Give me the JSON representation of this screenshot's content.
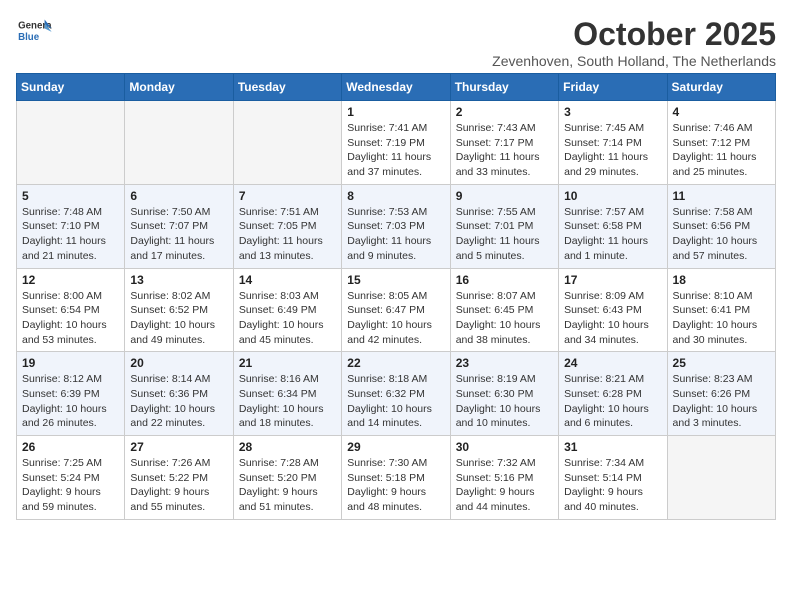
{
  "header": {
    "logo_line1": "General",
    "logo_line2": "Blue",
    "month": "October 2025",
    "location": "Zevenhoven, South Holland, The Netherlands"
  },
  "weekdays": [
    "Sunday",
    "Monday",
    "Tuesday",
    "Wednesday",
    "Thursday",
    "Friday",
    "Saturday"
  ],
  "weeks": [
    [
      {
        "day": "",
        "info": ""
      },
      {
        "day": "",
        "info": ""
      },
      {
        "day": "",
        "info": ""
      },
      {
        "day": "1",
        "info": "Sunrise: 7:41 AM\nSunset: 7:19 PM\nDaylight: 11 hours\nand 37 minutes."
      },
      {
        "day": "2",
        "info": "Sunrise: 7:43 AM\nSunset: 7:17 PM\nDaylight: 11 hours\nand 33 minutes."
      },
      {
        "day": "3",
        "info": "Sunrise: 7:45 AM\nSunset: 7:14 PM\nDaylight: 11 hours\nand 29 minutes."
      },
      {
        "day": "4",
        "info": "Sunrise: 7:46 AM\nSunset: 7:12 PM\nDaylight: 11 hours\nand 25 minutes."
      }
    ],
    [
      {
        "day": "5",
        "info": "Sunrise: 7:48 AM\nSunset: 7:10 PM\nDaylight: 11 hours\nand 21 minutes."
      },
      {
        "day": "6",
        "info": "Sunrise: 7:50 AM\nSunset: 7:07 PM\nDaylight: 11 hours\nand 17 minutes."
      },
      {
        "day": "7",
        "info": "Sunrise: 7:51 AM\nSunset: 7:05 PM\nDaylight: 11 hours\nand 13 minutes."
      },
      {
        "day": "8",
        "info": "Sunrise: 7:53 AM\nSunset: 7:03 PM\nDaylight: 11 hours\nand 9 minutes."
      },
      {
        "day": "9",
        "info": "Sunrise: 7:55 AM\nSunset: 7:01 PM\nDaylight: 11 hours\nand 5 minutes."
      },
      {
        "day": "10",
        "info": "Sunrise: 7:57 AM\nSunset: 6:58 PM\nDaylight: 11 hours\nand 1 minute."
      },
      {
        "day": "11",
        "info": "Sunrise: 7:58 AM\nSunset: 6:56 PM\nDaylight: 10 hours\nand 57 minutes."
      }
    ],
    [
      {
        "day": "12",
        "info": "Sunrise: 8:00 AM\nSunset: 6:54 PM\nDaylight: 10 hours\nand 53 minutes."
      },
      {
        "day": "13",
        "info": "Sunrise: 8:02 AM\nSunset: 6:52 PM\nDaylight: 10 hours\nand 49 minutes."
      },
      {
        "day": "14",
        "info": "Sunrise: 8:03 AM\nSunset: 6:49 PM\nDaylight: 10 hours\nand 45 minutes."
      },
      {
        "day": "15",
        "info": "Sunrise: 8:05 AM\nSunset: 6:47 PM\nDaylight: 10 hours\nand 42 minutes."
      },
      {
        "day": "16",
        "info": "Sunrise: 8:07 AM\nSunset: 6:45 PM\nDaylight: 10 hours\nand 38 minutes."
      },
      {
        "day": "17",
        "info": "Sunrise: 8:09 AM\nSunset: 6:43 PM\nDaylight: 10 hours\nand 34 minutes."
      },
      {
        "day": "18",
        "info": "Sunrise: 8:10 AM\nSunset: 6:41 PM\nDaylight: 10 hours\nand 30 minutes."
      }
    ],
    [
      {
        "day": "19",
        "info": "Sunrise: 8:12 AM\nSunset: 6:39 PM\nDaylight: 10 hours\nand 26 minutes."
      },
      {
        "day": "20",
        "info": "Sunrise: 8:14 AM\nSunset: 6:36 PM\nDaylight: 10 hours\nand 22 minutes."
      },
      {
        "day": "21",
        "info": "Sunrise: 8:16 AM\nSunset: 6:34 PM\nDaylight: 10 hours\nand 18 minutes."
      },
      {
        "day": "22",
        "info": "Sunrise: 8:18 AM\nSunset: 6:32 PM\nDaylight: 10 hours\nand 14 minutes."
      },
      {
        "day": "23",
        "info": "Sunrise: 8:19 AM\nSunset: 6:30 PM\nDaylight: 10 hours\nand 10 minutes."
      },
      {
        "day": "24",
        "info": "Sunrise: 8:21 AM\nSunset: 6:28 PM\nDaylight: 10 hours\nand 6 minutes."
      },
      {
        "day": "25",
        "info": "Sunrise: 8:23 AM\nSunset: 6:26 PM\nDaylight: 10 hours\nand 3 minutes."
      }
    ],
    [
      {
        "day": "26",
        "info": "Sunrise: 7:25 AM\nSunset: 5:24 PM\nDaylight: 9 hours\nand 59 minutes."
      },
      {
        "day": "27",
        "info": "Sunrise: 7:26 AM\nSunset: 5:22 PM\nDaylight: 9 hours\nand 55 minutes."
      },
      {
        "day": "28",
        "info": "Sunrise: 7:28 AM\nSunset: 5:20 PM\nDaylight: 9 hours\nand 51 minutes."
      },
      {
        "day": "29",
        "info": "Sunrise: 7:30 AM\nSunset: 5:18 PM\nDaylight: 9 hours\nand 48 minutes."
      },
      {
        "day": "30",
        "info": "Sunrise: 7:32 AM\nSunset: 5:16 PM\nDaylight: 9 hours\nand 44 minutes."
      },
      {
        "day": "31",
        "info": "Sunrise: 7:34 AM\nSunset: 5:14 PM\nDaylight: 9 hours\nand 40 minutes."
      },
      {
        "day": "",
        "info": ""
      }
    ]
  ],
  "colors": {
    "header_bg": "#2a6db5",
    "row_alt": "#f0f4fb"
  }
}
